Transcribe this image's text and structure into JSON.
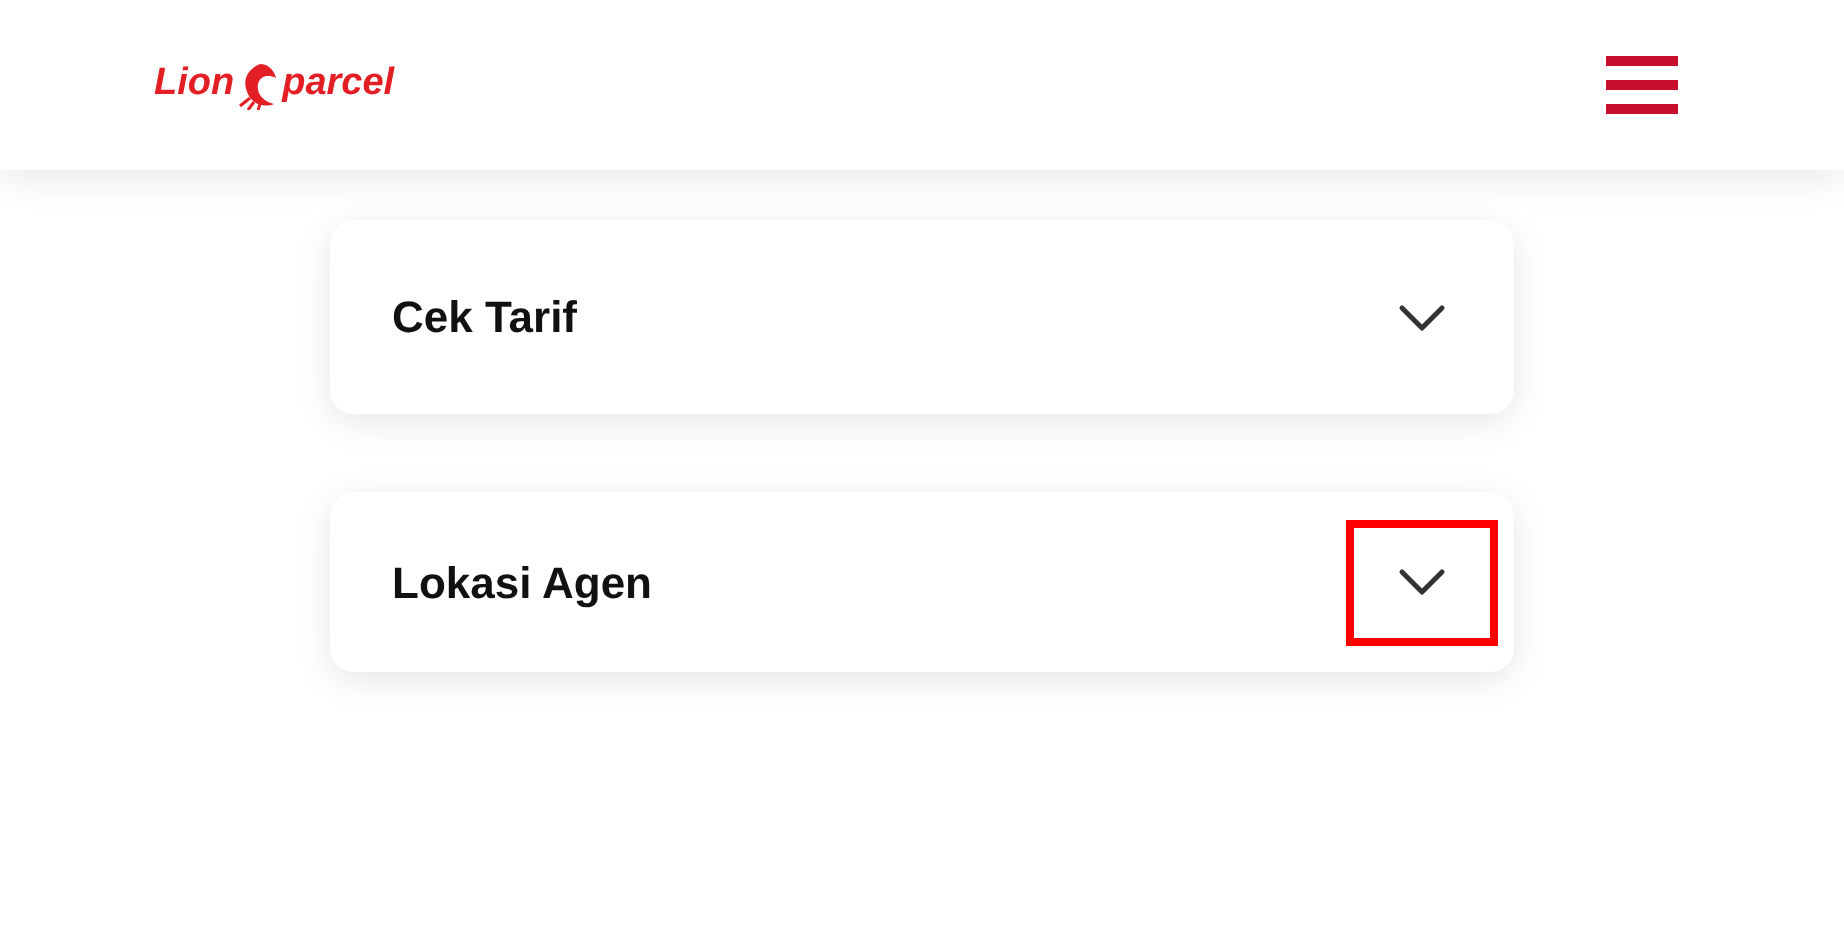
{
  "header": {
    "logo": {
      "left": "Lion",
      "right": "parcel"
    }
  },
  "accordion": [
    {
      "title": "Cek Tarif",
      "expanded": false,
      "highlighted": false
    },
    {
      "title": "Lokasi Agen",
      "expanded": false,
      "highlighted": true
    }
  ]
}
